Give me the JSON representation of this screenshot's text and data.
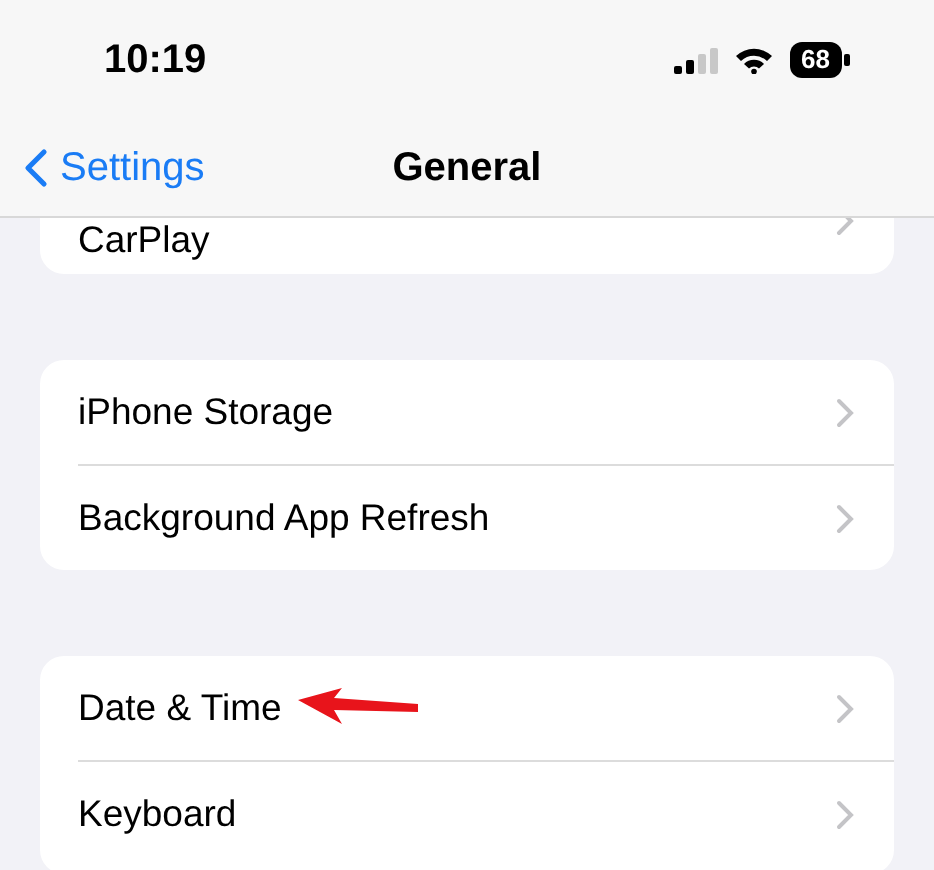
{
  "status_bar": {
    "time": "10:19",
    "battery": "68"
  },
  "nav": {
    "back": "Settings",
    "title": "General"
  },
  "groups": [
    {
      "partial": true,
      "rows": [
        {
          "label": "CarPlay",
          "pointed": false
        }
      ]
    },
    {
      "partial": false,
      "rows": [
        {
          "label": "iPhone Storage",
          "pointed": false
        },
        {
          "label": "Background App Refresh",
          "pointed": false
        }
      ]
    },
    {
      "partial": false,
      "rows": [
        {
          "label": "Date & Time",
          "pointed": true
        },
        {
          "label": "Keyboard",
          "pointed": false
        }
      ]
    }
  ]
}
